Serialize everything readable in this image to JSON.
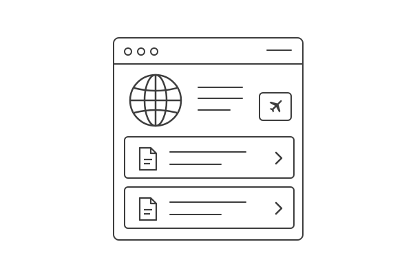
{
  "window": {
    "controls": [
      "control-dot-1",
      "control-dot-2",
      "control-dot-3"
    ],
    "menu_icon": "menu-line-icon"
  },
  "header": {
    "globe_icon": "globe-icon",
    "action_icon": "airplane-icon"
  },
  "list": {
    "items": [
      {
        "icon": "document-icon",
        "chevron": "chevron-right-icon"
      },
      {
        "icon": "document-icon",
        "chevron": "chevron-right-icon"
      }
    ]
  },
  "colors": {
    "stroke": "#3d3d3d",
    "background": "#ffffff"
  }
}
